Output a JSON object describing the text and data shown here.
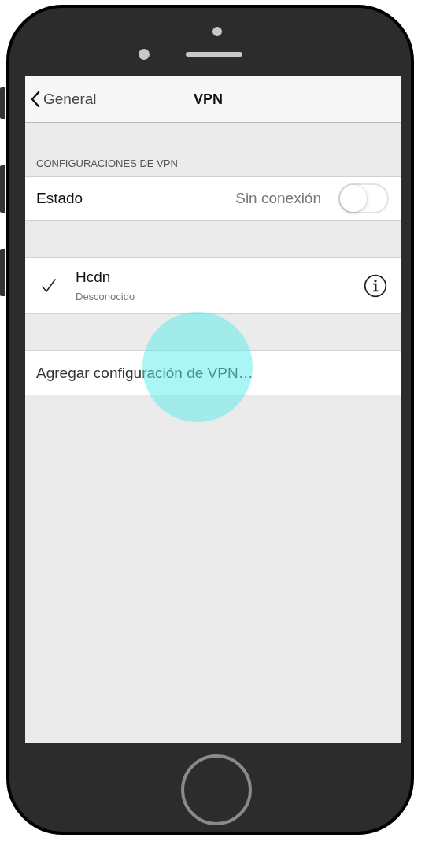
{
  "nav": {
    "back_label": "General",
    "title": "VPN"
  },
  "section_header": "CONFIGURACIONES DE VPN",
  "status_row": {
    "label": "Estado",
    "value": "Sin conexión",
    "on": false
  },
  "configurations": [
    {
      "name": "Hcdn",
      "status": "Desconocido",
      "selected": true
    }
  ],
  "add_row": {
    "label": "Agregar configuración de VPN…"
  }
}
